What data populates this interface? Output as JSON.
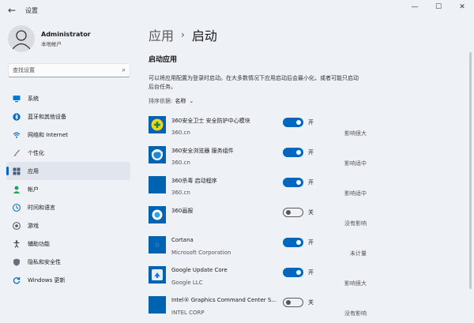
{
  "titlebar": {
    "title": "设置"
  },
  "profile": {
    "name": "Administrator",
    "account_type": "本地帐户"
  },
  "search": {
    "placeholder": "查找设置"
  },
  "nav": [
    {
      "label": "系统",
      "icon": "monitor-icon",
      "color": "#0078d4"
    },
    {
      "label": "蓝牙和其他设备",
      "icon": "bluetooth-icon",
      "color": "#0067c0"
    },
    {
      "label": "网络和 Internet",
      "icon": "wifi-icon",
      "color": "#0067c0"
    },
    {
      "label": "个性化",
      "icon": "brush-icon",
      "color": "#c06a2d"
    },
    {
      "label": "应用",
      "icon": "apps-icon",
      "color": "#4a5a78",
      "active": true
    },
    {
      "label": "帐户",
      "icon": "person-icon",
      "color": "#1fa05a"
    },
    {
      "label": "时间和语言",
      "icon": "globe-clock-icon",
      "color": "#0067c0"
    },
    {
      "label": "游戏",
      "icon": "gamepad-icon",
      "color": "#555555"
    },
    {
      "label": "辅助功能",
      "icon": "accessibility-icon",
      "color": "#333333"
    },
    {
      "label": "隐私和安全性",
      "icon": "shield-icon",
      "color": "#6b6f7a"
    },
    {
      "label": "Windows 更新",
      "icon": "update-icon",
      "color": "#0067c0"
    }
  ],
  "breadcrumb": {
    "parent": "应用",
    "separator": "›",
    "current": "启动"
  },
  "section": {
    "title": "启动应用",
    "description": "可以将应用配置为登录时启动。在大多数情况下应用启动后会最小化，或者可能只启动后台任务。",
    "sort_label": "排序依据:",
    "sort_value": "名称"
  },
  "apps": [
    {
      "name": "360安全卫士 安全防护中心模块",
      "publisher": "360.cn",
      "state": "开",
      "on": true,
      "impact": "影响很大",
      "icon": "360-safe-icon"
    },
    {
      "name": "360安全浏览器 服务组件",
      "publisher": "360.cn",
      "state": "开",
      "on": true,
      "impact": "影响适中",
      "icon": "360-browser-icon"
    },
    {
      "name": "360杀毒 启动程序",
      "publisher": "360.cn",
      "state": "开",
      "on": true,
      "impact": "影响适中",
      "icon": "360-antivirus-icon"
    },
    {
      "name": "360画报",
      "publisher": "",
      "state": "关",
      "on": false,
      "impact": "没有影响",
      "icon": "360-wallpaper-icon"
    },
    {
      "name": "Cortana",
      "publisher": "Microsoft Corporation",
      "state": "开",
      "on": true,
      "impact": "未计量",
      "icon": "cortana-icon"
    },
    {
      "name": "Google Update Core",
      "publisher": "Google LLC",
      "state": "开",
      "on": true,
      "impact": "影响很大",
      "icon": "google-update-icon"
    },
    {
      "name": "Intel® Graphics Command Center S...",
      "publisher": "INTEL CORP",
      "state": "关",
      "on": false,
      "impact": "没有影响",
      "icon": "intel-graphics-icon"
    }
  ],
  "colors": {
    "accent": "#0067c0",
    "tile_blue": "#0063b1",
    "background": "#eef1f6"
  }
}
